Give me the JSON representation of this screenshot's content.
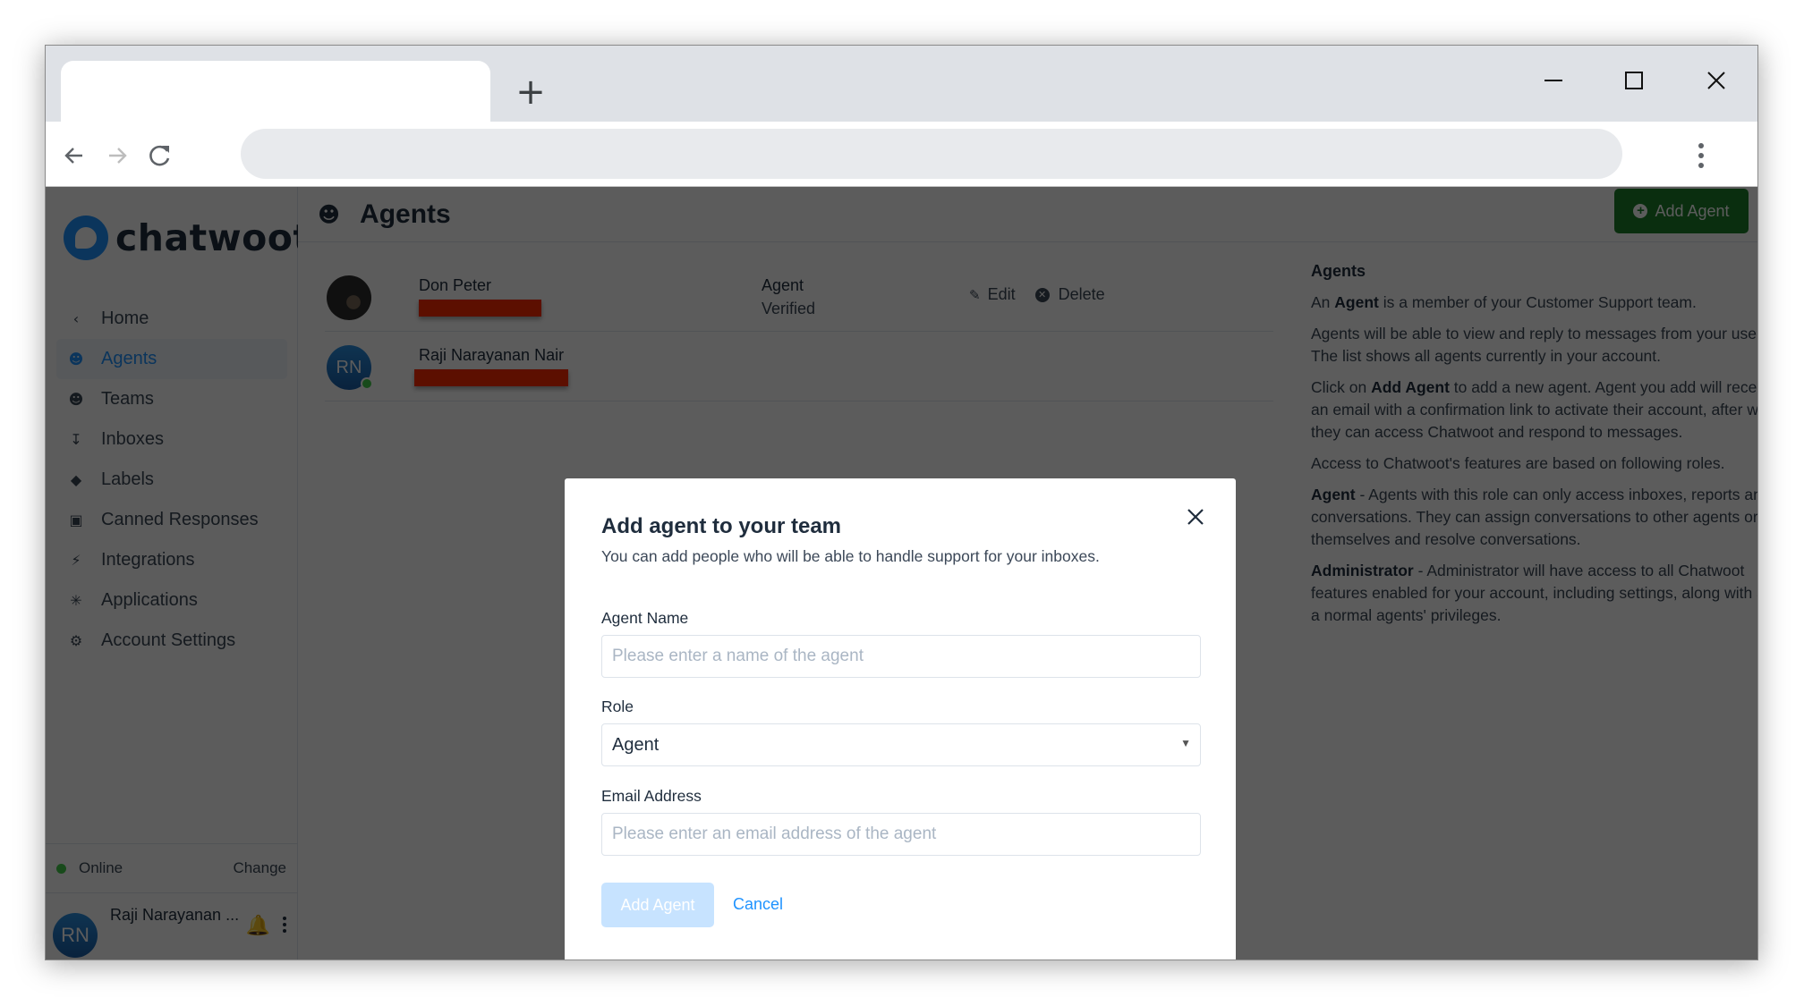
{
  "browser": {
    "new_tab_glyph": "+",
    "menu_icon": "vertical-dots-icon"
  },
  "app": {
    "logo_text": "chatwoot",
    "brand_color": "#1f93ff",
    "sidebar": {
      "items": [
        {
          "label": "Home",
          "icon": "chevron-left-icon",
          "glyph": "‹"
        },
        {
          "label": "Agents",
          "icon": "agents-icon",
          "glyph": "👥",
          "active": true
        },
        {
          "label": "Teams",
          "icon": "teams-icon",
          "glyph": "👪"
        },
        {
          "label": "Inboxes",
          "icon": "inbox-icon",
          "glyph": "📥"
        },
        {
          "label": "Labels",
          "icon": "tag-icon",
          "glyph": "🏷"
        },
        {
          "label": "Canned Responses",
          "icon": "chat-bubble-icon",
          "glyph": "💬"
        },
        {
          "label": "Integrations",
          "icon": "bolt-icon",
          "glyph": "⚡"
        },
        {
          "label": "Applications",
          "icon": "asterisk-icon",
          "glyph": "✳"
        },
        {
          "label": "Account Settings",
          "icon": "gear-icon",
          "glyph": "⚙"
        }
      ],
      "status": "Online",
      "status_change": "Change",
      "user_initials": "RN",
      "user_name": "Raji Narayanan ..."
    },
    "header": {
      "title": "Agents",
      "add_button": "Add Agent",
      "add_button_color": "#1d7f2b"
    },
    "agents": [
      {
        "name": "Don Peter",
        "role": "Agent",
        "verification": "Verified",
        "edit": "Edit",
        "delete": "Delete"
      },
      {
        "name": "Raji Narayanan Nair",
        "initials": "RN",
        "online": true
      }
    ],
    "help": {
      "title": "Agents",
      "p1_pre": "An ",
      "p1_bold": "Agent",
      "p1_post": " is a member of your Customer Support team.",
      "p2": "Agents will be able to view and reply to messages from your users. The list shows all agents currently in your account.",
      "p3_pre": "Click on ",
      "p3_bold": "Add Agent",
      "p3_post": " to add a new agent. Agent you add will receive an email with a confirmation link to activate their account, after which they can access Chatwoot and respond to messages.",
      "p4": "Access to Chatwoot's features are based on following roles.",
      "p5_bold": "Agent",
      "p5_post": " - Agents with this role can only access inboxes, reports and conversations. They can assign conversations to other agents or themselves and resolve conversations.",
      "p6_bold": "Administrator",
      "p6_post": " - Administrator will have access to all Chatwoot features enabled for your account, including settings, along with all of a normal agents' privileges."
    }
  },
  "modal": {
    "title": "Add agent to your team",
    "subtitle": "You can add people who will be able to handle support for your inboxes.",
    "name_label": "Agent Name",
    "name_placeholder": "Please enter a name of the agent",
    "name_value": "",
    "role_label": "Role",
    "role_value": "Agent",
    "email_label": "Email Address",
    "email_placeholder": "Please enter an email address of the agent",
    "email_value": "",
    "submit": "Add Agent",
    "cancel": "Cancel"
  }
}
